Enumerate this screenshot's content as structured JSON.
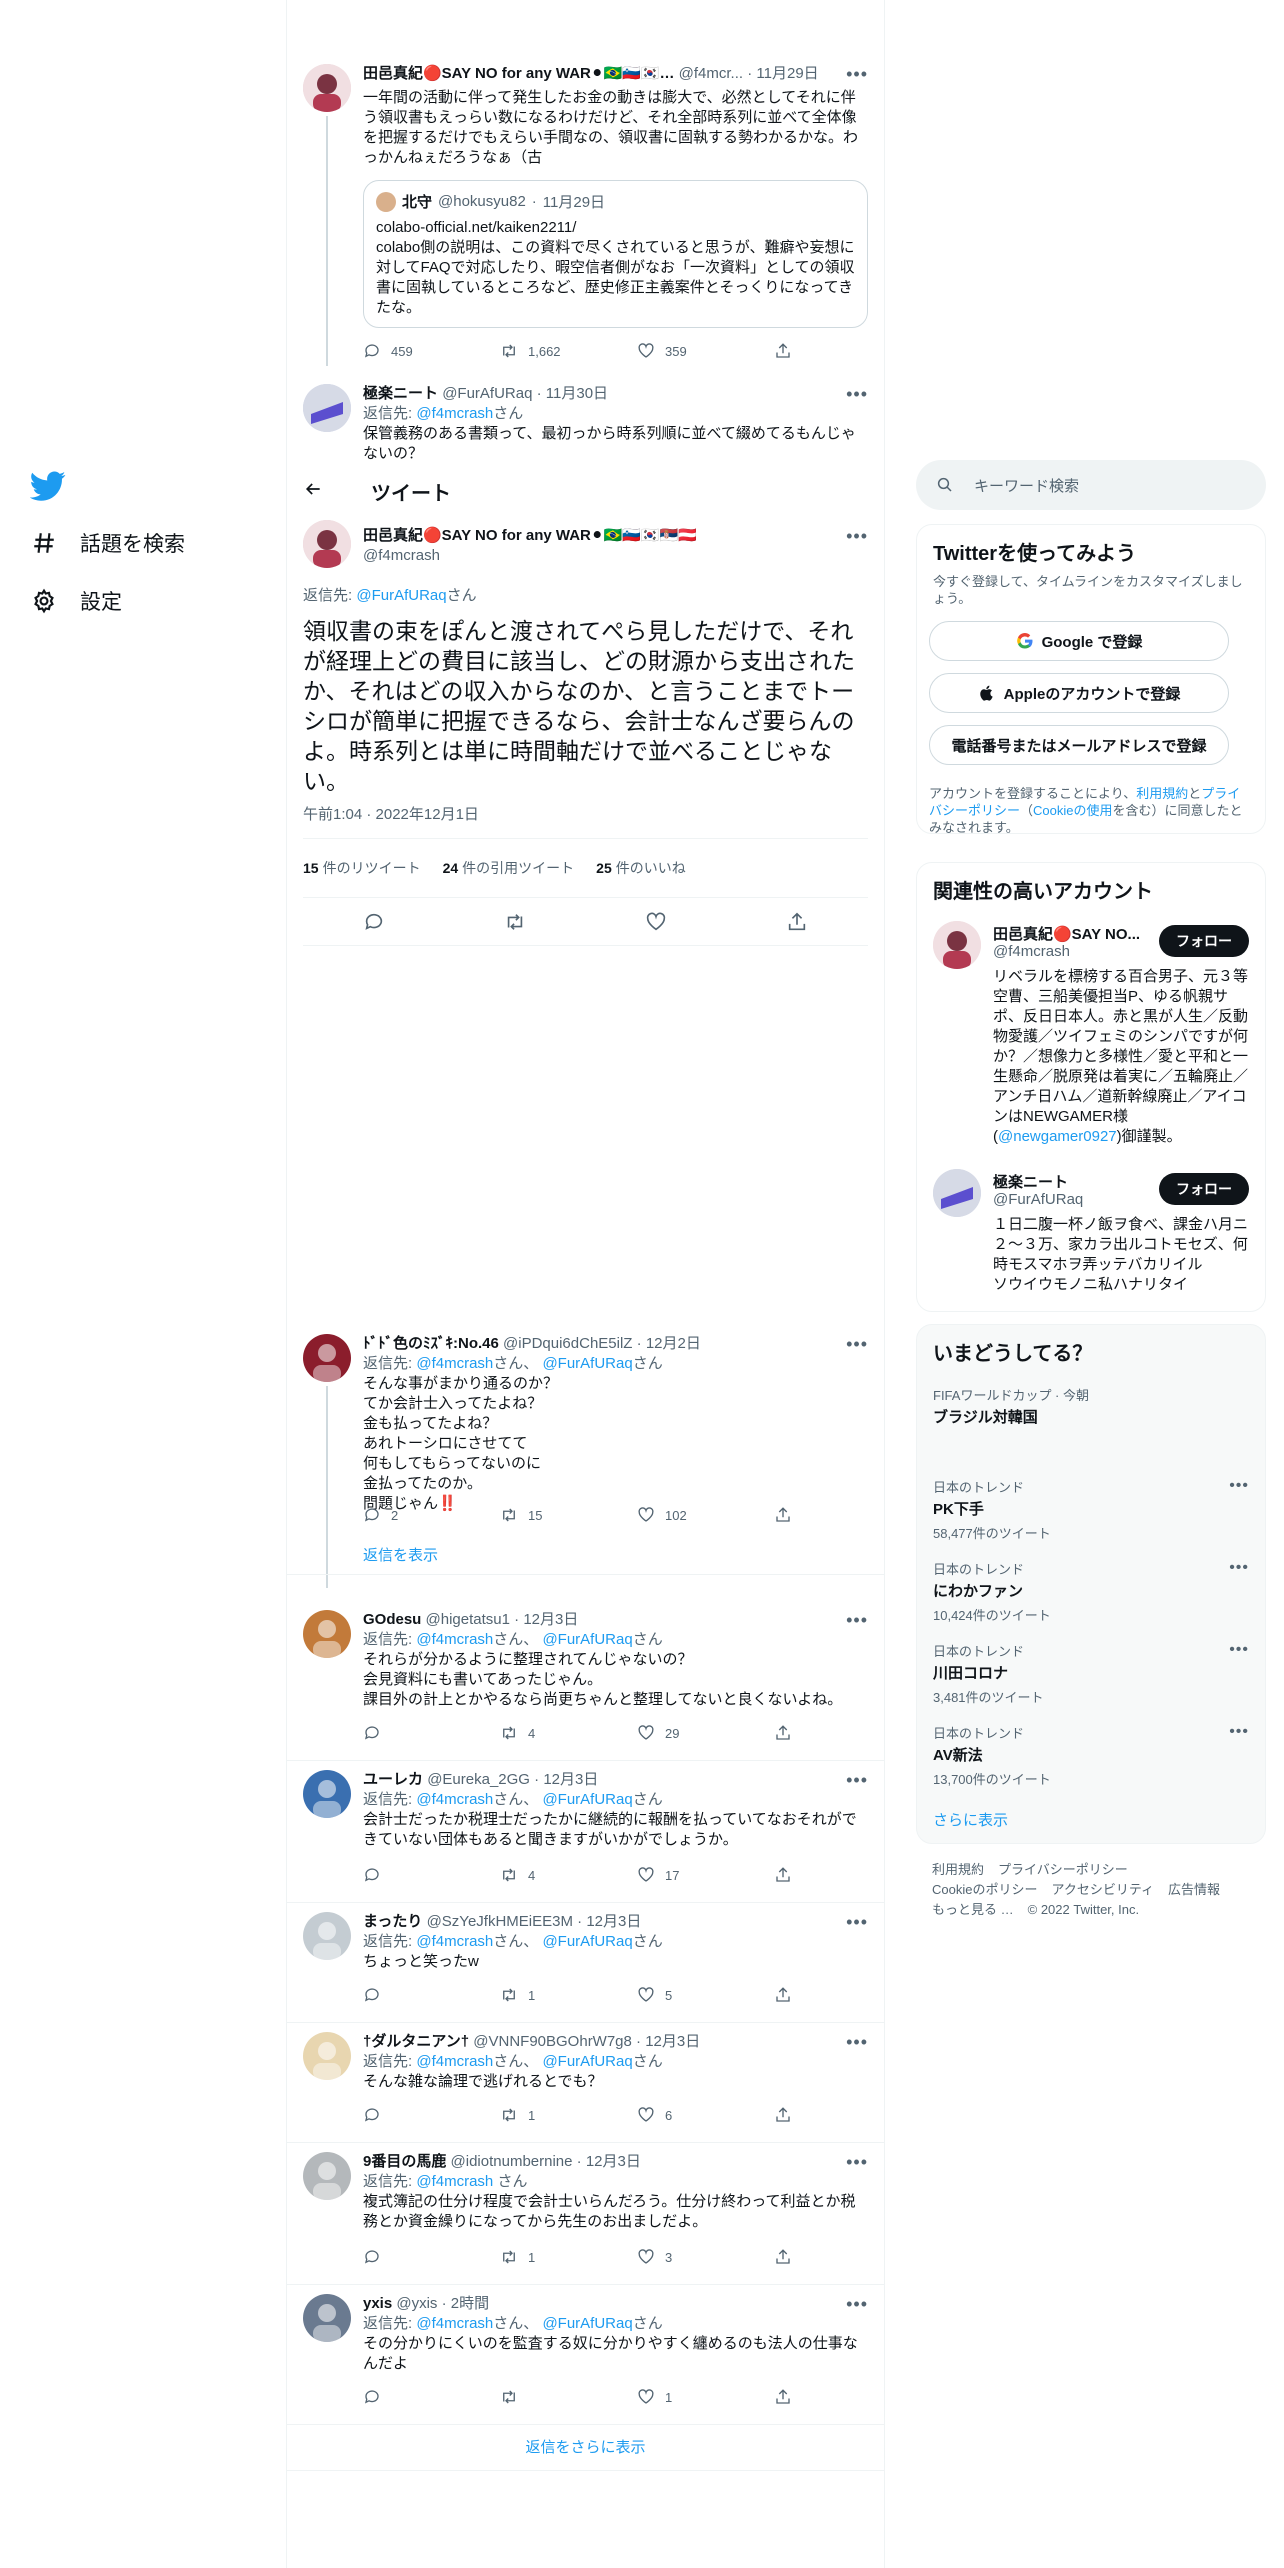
{
  "nav": {
    "items": [
      {
        "label": "話題を検索",
        "icon": "hashtag-icon"
      },
      {
        "label": "設定",
        "icon": "gear-icon"
      }
    ]
  },
  "thread": {
    "parent": {
      "name": "田邑真紀🔴SAY NO for any WAR⚫🇧🇷🇸🇮🇰🇷…",
      "handle": "@f4mcr...",
      "time": "11月29日",
      "text": "一年間の活動に伴って発生したお金の動きは膨大で、必然としてそれに伴う領収書もえっらい数になるわけだけど、それ全部時系列に並べて全体像を把握するだけでもえらい手間なの、領収書に固執する勢わかるかな。わっかんねぇだろうなぁ（古",
      "quote": {
        "name": "北守",
        "handle": "@hokusyu82",
        "time": "11月29日",
        "link": "colabo-official.net/kaiken2211/",
        "text": "colabo側の説明は、この資料で尽くされていると思うが、難癖や妄想に対してFAQで対応したり、暇空信者側がなお「一次資料」としての領収書に固執しているところなど、歴史修正主義案件とそっくりになってきたな。"
      },
      "replies": "459",
      "retweets": "1,662",
      "likes": "359"
    },
    "second": {
      "name": "極楽ニート",
      "handle": "@FurAfURaq",
      "time": "11月30日",
      "reply_prefix": "返信先:",
      "reply_to": "@f4mcrash",
      "reply_suffix": "さん",
      "text": "保管義務のある書類って、最初っから時系列順に並べて綴めてるもんじゃないの？"
    }
  },
  "header": {
    "title": "ツイート"
  },
  "focus": {
    "name": "田邑真紀🔴SAY NO for any WAR⚫🇧🇷🇸🇮🇰🇷🇷🇸🇦🇹",
    "handle": "@f4mcrash",
    "reply_prefix": "返信先:",
    "reply_to": "@FurAfURaq",
    "reply_suffix": "さん",
    "text": "領収書の束をぽんと渡されてぺら見しただけで、それが経理上どの費目に該当し、どの財源から支出されたか、それはどの収入からなのか、と言うことまでトーシロが簡単に把握できるなら、会計士なんざ要らんのよ。時系列とは単に時間軸だけで並べることじゃない。",
    "time": "午前1:04 · 2022年12月1日",
    "stats": [
      {
        "value": "15",
        "label": "件のリツイート"
      },
      {
        "value": "24",
        "label": "件の引用ツイート"
      },
      {
        "value": "25",
        "label": "件のいいね"
      }
    ]
  },
  "replies": [
    {
      "name": "ﾄﾞﾄﾞ色のﾐｽﾞｷ:No.46",
      "handle": "@iPDqui6dChE5ilZ",
      "time": "12月2日",
      "reply_prefix": "返信先:",
      "reply_to": "@f4mcrash",
      "reply_mid": "さん、",
      "reply_to2": "@FurAfURaq",
      "reply_suffix": "さん",
      "text": "そんな事がまかり通るのか？\nてか会計士入ってたよね？\n金も払ってたよね？\nあれトーシロにさせてて\n何もしてもらってないのに\n金払ってたのか。\n問題じゃん‼️",
      "replies": "2",
      "retweets": "15",
      "likes": "102",
      "show_replies": "返信を表示"
    },
    {
      "name": "GOdesu",
      "handle": "@higetatsu1",
      "time": "12月3日",
      "reply_prefix": "返信先:",
      "reply_to": "@f4mcrash",
      "reply_mid": "さん、",
      "reply_to2": "@FurAfURaq",
      "reply_suffix": "さん",
      "text": "それらが分かるように整理されてんじゃないの？\n会見資料にも書いてあったじゃん。\n課目外の計上とかやるなら尚更ちゃんと整理してないと良くないよね。",
      "replies": "",
      "retweets": "4",
      "likes": "29"
    },
    {
      "name": "ユーレカ",
      "handle": "@Eureka_2GG",
      "time": "12月3日",
      "reply_prefix": "返信先:",
      "reply_to": "@f4mcrash",
      "reply_mid": "さん、",
      "reply_to2": "@FurAfURaq",
      "reply_suffix": "さん",
      "text": "会計士だったか税理士だったかに継続的に報酬を払っていてなおそれができていない団体もあると聞きますがいかがでしょうか。",
      "replies": "",
      "retweets": "4",
      "likes": "17"
    },
    {
      "name": "まったり",
      "handle": "@SzYeJfkHMEiEE3M",
      "time": "12月3日",
      "reply_prefix": "返信先:",
      "reply_to": "@f4mcrash",
      "reply_mid": "さん、",
      "reply_to2": "@FurAfURaq",
      "reply_suffix": "さん",
      "text": "ちょっと笑ったw",
      "replies": "",
      "retweets": "1",
      "likes": "5"
    },
    {
      "name": "†ダルタニアン†",
      "handle": "@VNNF90BGOhrW7g8",
      "time": "12月3日",
      "reply_prefix": "返信先:",
      "reply_to": "@f4mcrash",
      "reply_mid": "さん、",
      "reply_to2": "@FurAfURaq",
      "reply_suffix": "さん",
      "text": "そんな雑な論理で逃げれるとでも？",
      "replies": "",
      "retweets": "1",
      "likes": "6"
    },
    {
      "name": "9番目の馬鹿",
      "handle": "@idiotnumbernine",
      "time": "12月3日",
      "reply_prefix": "返信先:",
      "reply_to": "@f4mcrash",
      "reply_mid": "",
      "reply_to2": "",
      "reply_suffix": "さん",
      "text": "複式簿記の仕分け程度で会計士いらんだろう。仕分け終わって利益とか税務とか資金繰りになってから先生のお出ましだよ。",
      "replies": "",
      "retweets": "1",
      "likes": "3"
    },
    {
      "name": "yxis",
      "handle": "@yxis",
      "time": "2時間",
      "reply_prefix": "返信先:",
      "reply_to": "@f4mcrash",
      "reply_mid": "さん、",
      "reply_to2": "@FurAfURaq",
      "reply_suffix": "さん",
      "text": "その分かりにくいのを監査する奴に分かりやすく纏めるのも法人の仕事なんだよ",
      "replies": "",
      "retweets": "",
      "likes": "1"
    }
  ],
  "more_replies": "返信をさらに表示",
  "right": {
    "search_placeholder": "キーワード検索",
    "signup": {
      "title": "Twitterを使ってみよう",
      "subtitle": "今すぐ登録して、タイムラインをカスタマイズしましょう。",
      "google": "Google で登録",
      "apple": "Appleのアカウントで登録",
      "phone": "電話番号またはメールアドレスで登録",
      "terms_a": "アカウントを登録することにより、",
      "terms_link1": "利用規約",
      "terms_b": "と",
      "terms_link2": "プライバシーポリシー",
      "terms_c": "（",
      "terms_link3": "Cookieの使用",
      "terms_d": "を含む）に同意したとみなされます。"
    },
    "related": {
      "title": "関連性の高いアカウント",
      "accounts": [
        {
          "name": "田邑真紀🔴SAY NO...",
          "handle": "@f4mcrash",
          "follow": "フォロー",
          "bio": "リベラルを標榜する百合男子、元３等空曹、三船美優担当P、ゆる帆親サポ、反日日本人。赤と黒が人生／反動物愛護／ツイフェミのシンパですが何か？／想像力と多様性／愛と平和と一生懸命／脱原発は着実に／五輪廃止／アンチ日ハム／道新幹線廃止／アイコンはNEWGAMER様(",
          "bio_link": "@newgamer0927",
          "bio_end": ")御謹製。"
        },
        {
          "name": "極楽ニート",
          "handle": "@FurAfURaq",
          "follow": "フォロー",
          "bio": "１日二腹一杯ノ飯ヲ食べ、課金ハ月ニ２～３万、家カラ出ルコトモセズ、何時モスマホヲ弄ッテバカリイル\nソウイウモノニ私ハナリタイ",
          "bio_link": "",
          "bio_end": ""
        }
      ]
    },
    "trends": {
      "title": "いまどうしてる？",
      "items": [
        {
          "context": "FIFAワールドカップ · 今朝",
          "title": "ブラジル対韓国",
          "count": ""
        },
        {
          "context": "日本のトレンド",
          "title": "PK下手",
          "count": "58,477件のツイート"
        },
        {
          "context": "日本のトレンド",
          "title": "にわかファン",
          "count": "10,424件のツイート"
        },
        {
          "context": "日本のトレンド",
          "title": "川田コロナ",
          "count": "3,481件のツイート"
        },
        {
          "context": "日本のトレンド",
          "title": "AV新法",
          "count": "13,700件のツイート"
        }
      ],
      "show_more": "さらに表示"
    },
    "footer": {
      "links": [
        "利用規約",
        "プライバシーポリシー",
        "Cookieのポリシー",
        "アクセシビリティ",
        "広告情報",
        "もっと見る …"
      ],
      "copyright": "© 2022 Twitter, Inc."
    }
  },
  "colors": {
    "accent": "#1d9bf0",
    "text": "#0f1419",
    "muted": "#536471",
    "border": "#eff3f4"
  }
}
